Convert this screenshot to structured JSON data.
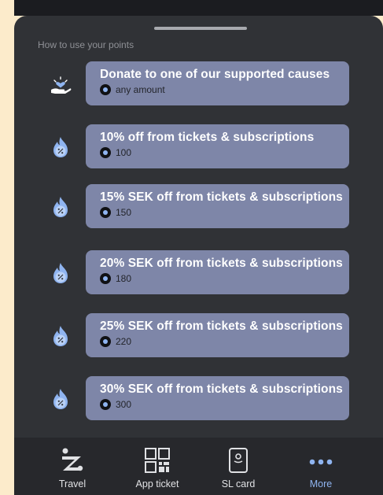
{
  "section_title": "How to use your points",
  "options": [
    {
      "title": "Donate to one of our supported causes",
      "points": "any amount",
      "icon": "heart-hand-icon"
    },
    {
      "title": "10% off from tickets & subscriptions",
      "points": "100",
      "icon": "discount-flame-icon"
    },
    {
      "title": "15% SEK off from tickets & subscriptions",
      "points": "150",
      "icon": "discount-flame-icon"
    },
    {
      "title": "20% SEK off from tickets & subscriptions",
      "points": "180",
      "icon": "discount-flame-icon"
    },
    {
      "title": "25% SEK off from tickets & subscriptions",
      "points": "220",
      "icon": "discount-flame-icon"
    },
    {
      "title": "30% SEK off from tickets & subscriptions",
      "points": "300",
      "icon": "discount-flame-icon"
    }
  ],
  "nav": [
    {
      "label": "Travel",
      "icon": "travel-icon"
    },
    {
      "label": "App ticket",
      "icon": "qr-code-icon"
    },
    {
      "label": "SL card",
      "icon": "sl-card-icon"
    },
    {
      "label": "More",
      "icon": "more-dots-icon",
      "active": true
    }
  ],
  "colors": {
    "card": "#7e86a8",
    "accent": "#8fb4f0",
    "sheet": "#303236",
    "nav": "#27282c"
  }
}
